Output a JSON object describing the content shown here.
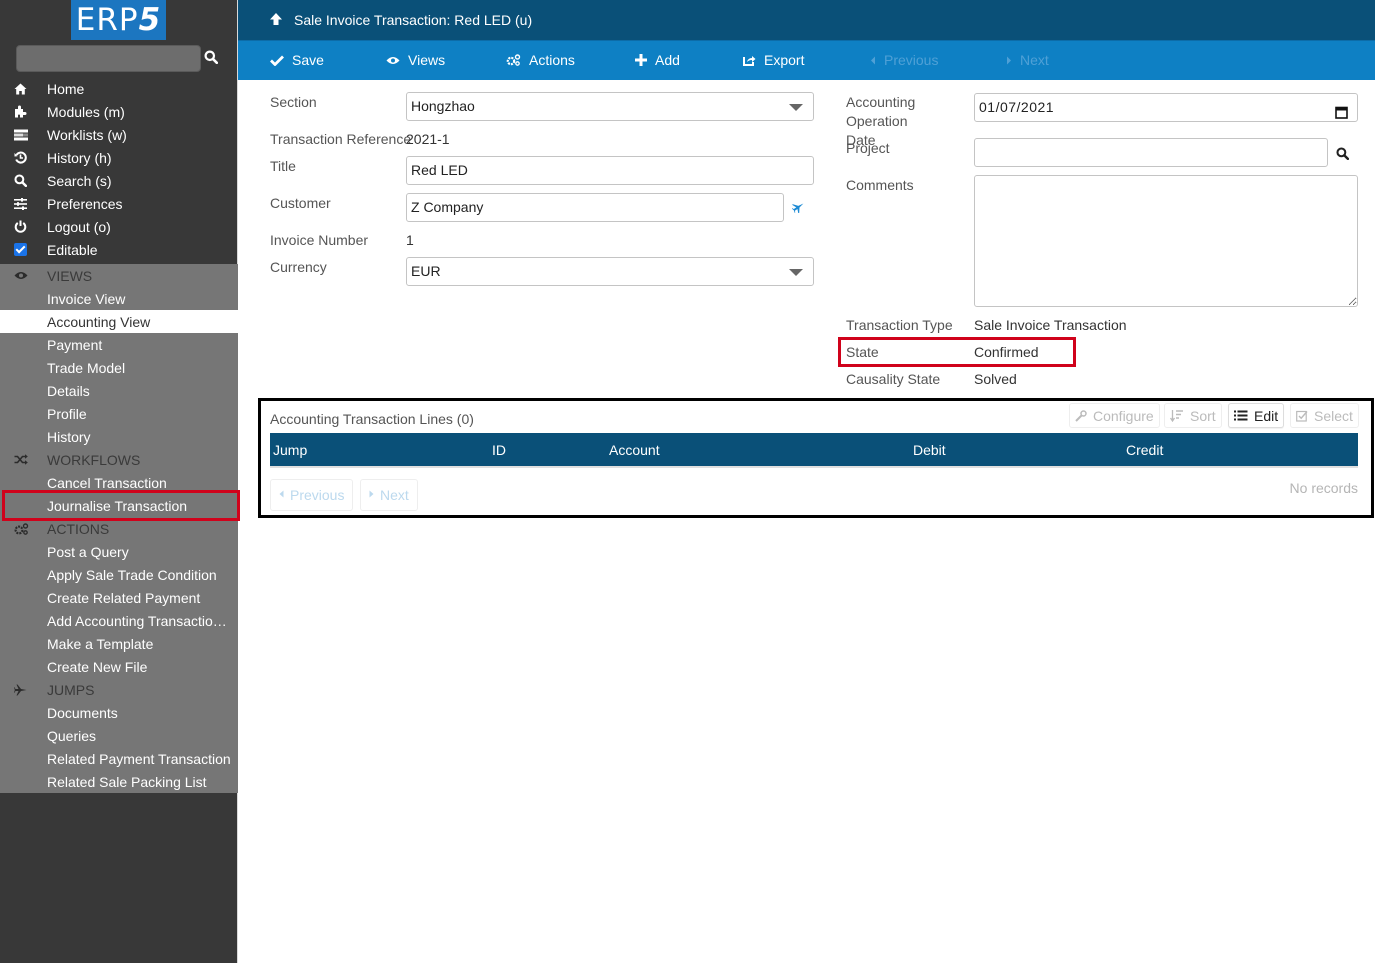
{
  "app": {
    "logo_text": "ERP",
    "logo_digit": "5",
    "accent_color": "#0e80c4",
    "header_color": "#0a5078"
  },
  "sidebar": {
    "search": {
      "value": "",
      "placeholder": ""
    },
    "top_items": [
      {
        "label": "Home",
        "icon": "home-icon"
      },
      {
        "label": "Modules (m)",
        "icon": "puzzle-icon"
      },
      {
        "label": "Worklists (w)",
        "icon": "tasks-icon"
      },
      {
        "label": "History (h)",
        "icon": "history-icon"
      },
      {
        "label": "Search (s)",
        "icon": "search-icon"
      },
      {
        "label": "Preferences",
        "icon": "sliders-icon"
      },
      {
        "label": "Logout (o)",
        "icon": "power-icon"
      },
      {
        "label": "Editable",
        "icon": "checkbox-icon",
        "checked": true
      }
    ],
    "views": {
      "header": "VIEWS",
      "items": [
        "Invoice View",
        "Accounting View",
        "Payment",
        "Trade Model",
        "Details",
        "Profile",
        "History"
      ],
      "active": "Accounting View"
    },
    "workflows": {
      "header": "WORKFLOWS",
      "items": [
        "Cancel Transaction",
        "Journalise Transaction"
      ],
      "highlighted": "Journalise Transaction"
    },
    "actions": {
      "header": "ACTIONS",
      "items": [
        "Post a Query",
        "Apply Sale Trade Condition",
        "Create Related Payment",
        "Add Accounting Transaction L...",
        "Make a Template",
        "Create New File"
      ]
    },
    "jumps": {
      "header": "JUMPS",
      "items": [
        "Documents",
        "Queries",
        "Related Payment Transaction",
        "Related Sale Packing List"
      ]
    }
  },
  "header": {
    "title": "Sale Invoice Transaction: Red LED (u)"
  },
  "toolbar": {
    "save": "Save",
    "views": "Views",
    "actions": "Actions",
    "add": "Add",
    "export": "Export",
    "previous": "Previous",
    "next": "Next"
  },
  "form": {
    "left": {
      "section": {
        "label": "Section",
        "value": "Hongzhao"
      },
      "transaction_reference": {
        "label": "Transaction Reference",
        "value": "2021-1"
      },
      "title": {
        "label": "Title",
        "value": "Red LED"
      },
      "customer": {
        "label": "Customer",
        "value": "Z Company"
      },
      "invoice_number": {
        "label": "Invoice Number",
        "value": "1"
      },
      "currency": {
        "label": "Currency",
        "value": "EUR"
      }
    },
    "right": {
      "operation_date": {
        "label_line1": "Accounting Operation",
        "label_line2": "Date",
        "value": "01/07/2021"
      },
      "project": {
        "label": "Project",
        "value": ""
      },
      "comments": {
        "label": "Comments",
        "value": ""
      },
      "transaction_type": {
        "label": "Transaction Type",
        "value": "Sale Invoice Transaction"
      },
      "state": {
        "label": "State",
        "value": "Confirmed"
      },
      "causality_state": {
        "label": "Causality State",
        "value": "Solved"
      }
    }
  },
  "listbox": {
    "title": "Accounting Transaction Lines (0)",
    "buttons": {
      "configure": "Configure",
      "sort": "Sort",
      "edit": "Edit",
      "select": "Select"
    },
    "columns": [
      "Jump",
      "ID",
      "Account",
      "Debit",
      "Credit"
    ],
    "rows": [],
    "empty_text": "No records",
    "pagination": {
      "previous": "Previous",
      "next": "Next"
    }
  }
}
